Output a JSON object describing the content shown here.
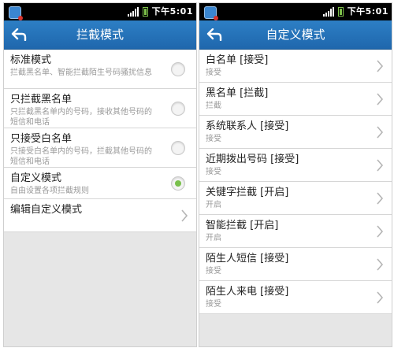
{
  "status": {
    "time": "下午5:01"
  },
  "left": {
    "title": "拦截模式",
    "items": [
      {
        "label": "标准模式",
        "desc": "拦截黑名单、智能拦截陌生号码骚扰信息",
        "selected": false
      },
      {
        "label": "只拦截黑名单",
        "desc": "只拦截黑名单内的号码，接收其他号码的短信和电话",
        "selected": false
      },
      {
        "label": "只接受白名单",
        "desc": "只接受白名单内的号码，拦截其他号码的短信和电话",
        "selected": false
      },
      {
        "label": "自定义模式",
        "desc": "自由设置各项拦截规则",
        "selected": true
      },
      {
        "label": "编辑自定义模式"
      }
    ]
  },
  "right": {
    "title": "自定义模式",
    "items": [
      {
        "label": "白名单 [接受]",
        "desc": "接受"
      },
      {
        "label": "黑名单 [拦截]",
        "desc": "拦截"
      },
      {
        "label": "系统联系人 [接受]",
        "desc": "接受"
      },
      {
        "label": "近期拨出号码 [接受]",
        "desc": "接受"
      },
      {
        "label": "关键字拦截 [开启]",
        "desc": "开启"
      },
      {
        "label": "智能拦截 [开启]",
        "desc": "开启"
      },
      {
        "label": "陌生人短信 [接受]",
        "desc": "接受"
      },
      {
        "label": "陌生人来电 [接受]",
        "desc": "接受"
      }
    ]
  },
  "colors": {
    "titlebar": "#1f67ad",
    "radio_on": "#79c04c"
  }
}
